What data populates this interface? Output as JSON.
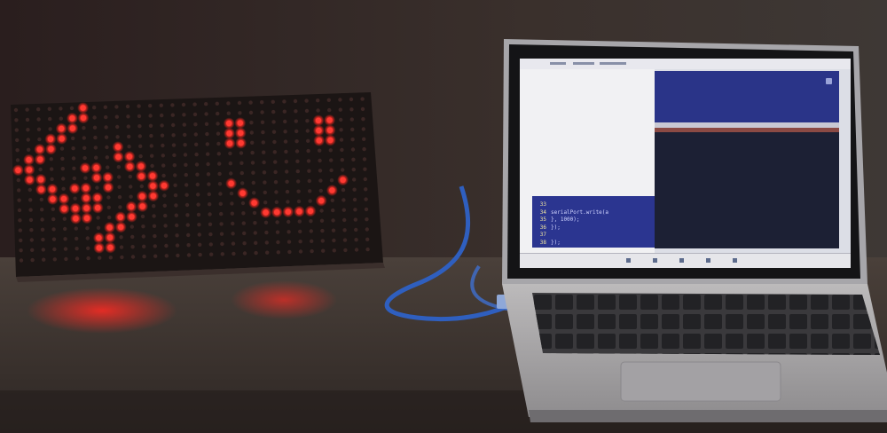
{
  "code_lines": [
    {
      "num": "33",
      "text": ""
    },
    {
      "num": "34",
      "text": "serialPort.write(a"
    },
    {
      "num": "35",
      "text": "}, 1000);"
    },
    {
      "num": "36",
      "text": "});"
    },
    {
      "num": "37",
      "text": ""
    },
    {
      "num": "38",
      "text": "});"
    }
  ],
  "colors": {
    "led_on": "#ff3a32",
    "led_off": "#3a2624",
    "screen_blue": "#2a3488",
    "terminal_dark": "#1c2034"
  }
}
